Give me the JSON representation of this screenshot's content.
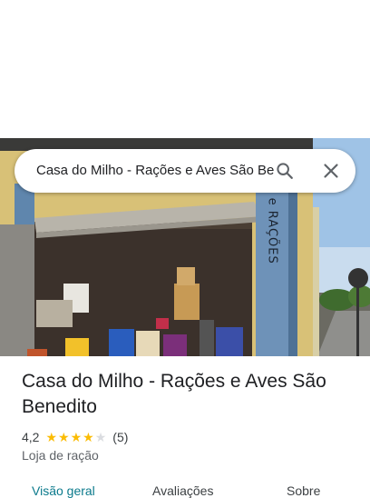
{
  "search": {
    "query": "Casa do Milho - Rações e Aves São Benedito"
  },
  "photo": {
    "wall_sign": "MILHO e RAÇÕES"
  },
  "place": {
    "name": "Casa do Milho - Rações e Aves São Benedito",
    "rating": "4,2",
    "rating_value": 4.2,
    "stars_total": 5,
    "review_count": "(5)",
    "category": "Loja de ração"
  },
  "tabs": [
    {
      "label": "Visão geral",
      "active": true
    },
    {
      "label": "Avaliações",
      "active": false
    },
    {
      "label": "Sobre",
      "active": false
    }
  ],
  "colors": {
    "star_filled": "#fbbc04",
    "star_empty": "#dadce0",
    "accent": "#0b7a8c"
  },
  "icons": {
    "search": "search-icon",
    "close": "close-icon"
  }
}
